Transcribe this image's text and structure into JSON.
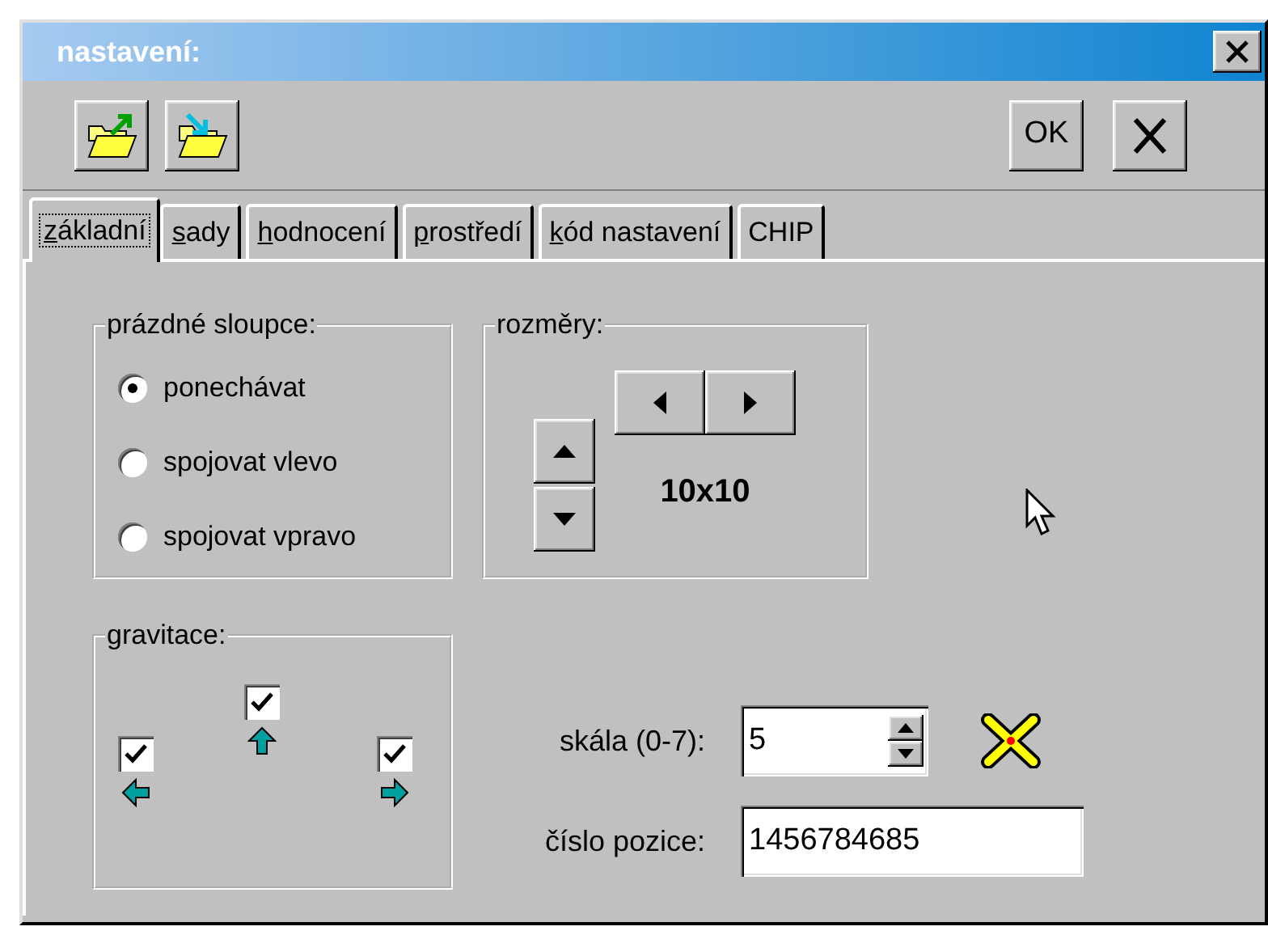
{
  "window": {
    "title": "nastavení:"
  },
  "toolbar": {
    "ok_label": "OK"
  },
  "tabs": [
    {
      "label": "základní",
      "selected": true,
      "mnemonic": true
    },
    {
      "label": "sady",
      "selected": false,
      "mnemonic": true
    },
    {
      "label": "hodnocení",
      "selected": false,
      "mnemonic": true
    },
    {
      "label": "prostředí",
      "selected": false,
      "mnemonic": true
    },
    {
      "label": "kód nastavení",
      "selected": false,
      "mnemonic": true
    },
    {
      "label": "CHIP",
      "selected": false,
      "mnemonic": false
    }
  ],
  "empty_columns": {
    "title": "prázdné sloupce:",
    "options": [
      {
        "label": "ponechávat",
        "selected": true
      },
      {
        "label": "spojovat vlevo",
        "selected": false
      },
      {
        "label": "spojovat vpravo",
        "selected": false
      }
    ]
  },
  "dimensions": {
    "title": "rozměry:",
    "value": "10x10"
  },
  "gravity": {
    "title": "gravitace:",
    "checks": [
      {
        "kind": "left",
        "checked": true
      },
      {
        "kind": "up",
        "checked": true
      },
      {
        "kind": "right",
        "checked": true
      }
    ]
  },
  "scale": {
    "label": "skála (0-7):",
    "value": "5"
  },
  "position": {
    "label": "číslo pozice:",
    "value": "1456784685"
  }
}
